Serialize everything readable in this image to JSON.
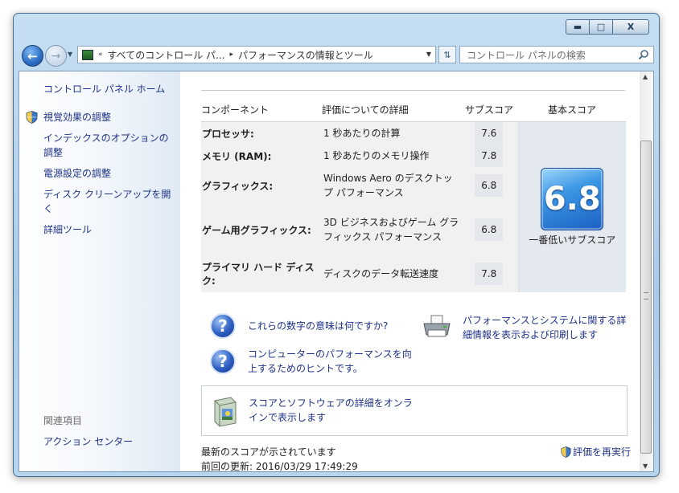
{
  "window": {
    "controls": {
      "minimize": "▬",
      "maximize": "□",
      "close": "X"
    }
  },
  "navbar": {
    "back_icon": "arrow-left-icon",
    "address": {
      "chevron": "«",
      "segment_1": "すべてのコントロール パ...",
      "separator": "▸",
      "segment_2": "パフォーマンスの情報とツール"
    },
    "search_placeholder": "コントロール パネルの検索"
  },
  "sidebar": {
    "home": "コントロール パネル ホーム",
    "items": [
      "視覚効果の調整",
      "インデックスのオプションの調整",
      "電源設定の調整",
      "ディスク クリーンアップを開く",
      "詳細ツール"
    ],
    "related_header": "関連項目",
    "related_items": [
      "アクション センター"
    ]
  },
  "table": {
    "headers": {
      "component": "コンポーネント",
      "detail": "評価についての詳細",
      "subscore": "サブスコア",
      "basescore": "基本スコア"
    },
    "rows": [
      {
        "component": "プロセッサ:",
        "detail": "1 秒あたりの計算",
        "subscore": "7.6"
      },
      {
        "component": "メモリ (RAM):",
        "detail": "1 秒あたりのメモリ操作",
        "subscore": "7.8"
      },
      {
        "component": "グラフィックス:",
        "detail": "Windows Aero のデスクトップ パフォーマンス",
        "subscore": "6.8"
      },
      {
        "component": "ゲーム用グラフィックス:",
        "detail": "3D ビジネスおよびゲーム グラフィックス パフォーマンス",
        "subscore": "6.8"
      },
      {
        "component": "プライマリ ハード ディスク:",
        "detail": "ディスクのデータ転送速度",
        "subscore": "7.8"
      }
    ],
    "base_score": "6.8",
    "base_score_label": "一番低いサブスコア"
  },
  "links": {
    "meaning": "これらの数字の意味は何ですか?",
    "print": "パフォーマンスとシステムに関する詳細情報を表示および印刷します",
    "tips": "コンピューターのパフォーマンスを向上するためのヒントです。",
    "online": "スコアとソフトウェアの詳細をオンラインで表示します"
  },
  "status": {
    "line1": "最新のスコアが示されています",
    "line2": "前回の更新: 2016/03/29 17:49:29",
    "rerun": "評価を再実行"
  }
}
